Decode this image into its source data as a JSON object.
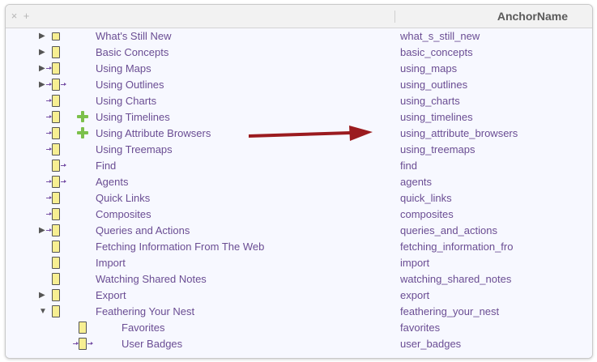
{
  "header": {
    "close_icon": "×",
    "add_icon": "+",
    "column_title": "AnchorName"
  },
  "rows": [
    {
      "name": "What's Still New",
      "anchor": "what_s_still_new",
      "disclosure": "▶",
      "icon": "closed-note-icon"
    },
    {
      "name": "Basic Concepts",
      "anchor": "basic_concepts",
      "disclosure": "▶",
      "icon": "note-icon"
    },
    {
      "name": "Using Maps",
      "anchor": "using_maps",
      "disclosure": "▶",
      "icon": "linked-note-icon"
    },
    {
      "name": "Using Outlines",
      "anchor": "using_outlines",
      "disclosure": "▶",
      "icon": "linked-note-icon"
    },
    {
      "name": "Using Charts",
      "anchor": "using_charts",
      "disclosure": "",
      "icon": "linked-note-icon"
    },
    {
      "name": "Using Timelines",
      "anchor": "using_timelines",
      "disclosure": "",
      "icon": "linked-note-icon",
      "badge": "plus-badge-icon"
    },
    {
      "name": "Using Attribute Browsers",
      "anchor": "using_attribute_browsers",
      "disclosure": "",
      "icon": "linked-note-icon",
      "badge": "plus-badge-icon"
    },
    {
      "name": "Using Treemaps",
      "anchor": "using_treemaps",
      "disclosure": "",
      "icon": "linked-note-icon"
    },
    {
      "name": "Find",
      "anchor": "find",
      "disclosure": "",
      "icon": "outlink-note-icon"
    },
    {
      "name": "Agents",
      "anchor": "agents",
      "disclosure": "",
      "icon": "linked-note-icon"
    },
    {
      "name": "Quick Links",
      "anchor": "quick_links",
      "disclosure": "",
      "icon": "linked-note-icon"
    },
    {
      "name": "Composites",
      "anchor": "composites",
      "disclosure": "",
      "icon": "linked-note-icon"
    },
    {
      "name": "Queries and Actions",
      "anchor": "queries_and_actions",
      "disclosure": "▶",
      "icon": "linked-note-icon"
    },
    {
      "name": "Fetching Information From The Web",
      "anchor": "fetching_information_fro",
      "disclosure": "",
      "icon": "note-icon"
    },
    {
      "name": "Import",
      "anchor": "import",
      "disclosure": "",
      "icon": "note-icon"
    },
    {
      "name": "Watching Shared Notes",
      "anchor": "watching_shared_notes",
      "disclosure": "",
      "icon": "note-icon"
    },
    {
      "name": "Export",
      "anchor": "export",
      "disclosure": "▶",
      "icon": "note-icon"
    },
    {
      "name": "Feathering Your Nest",
      "anchor": "feathering_your_nest",
      "disclosure": "▼",
      "icon": "note-icon"
    },
    {
      "name": "Favorites",
      "anchor": "favorites",
      "disclosure": "",
      "icon": "note-icon",
      "child": true
    },
    {
      "name": "User Badges",
      "anchor": "user_badges",
      "disclosure": "",
      "icon": "linked-note-icon",
      "child": true
    }
  ],
  "colors": {
    "text": "#6a4d93",
    "background": "#f7f8ff",
    "arrow": "#9b1b1f",
    "badge": "#7cc04b"
  }
}
